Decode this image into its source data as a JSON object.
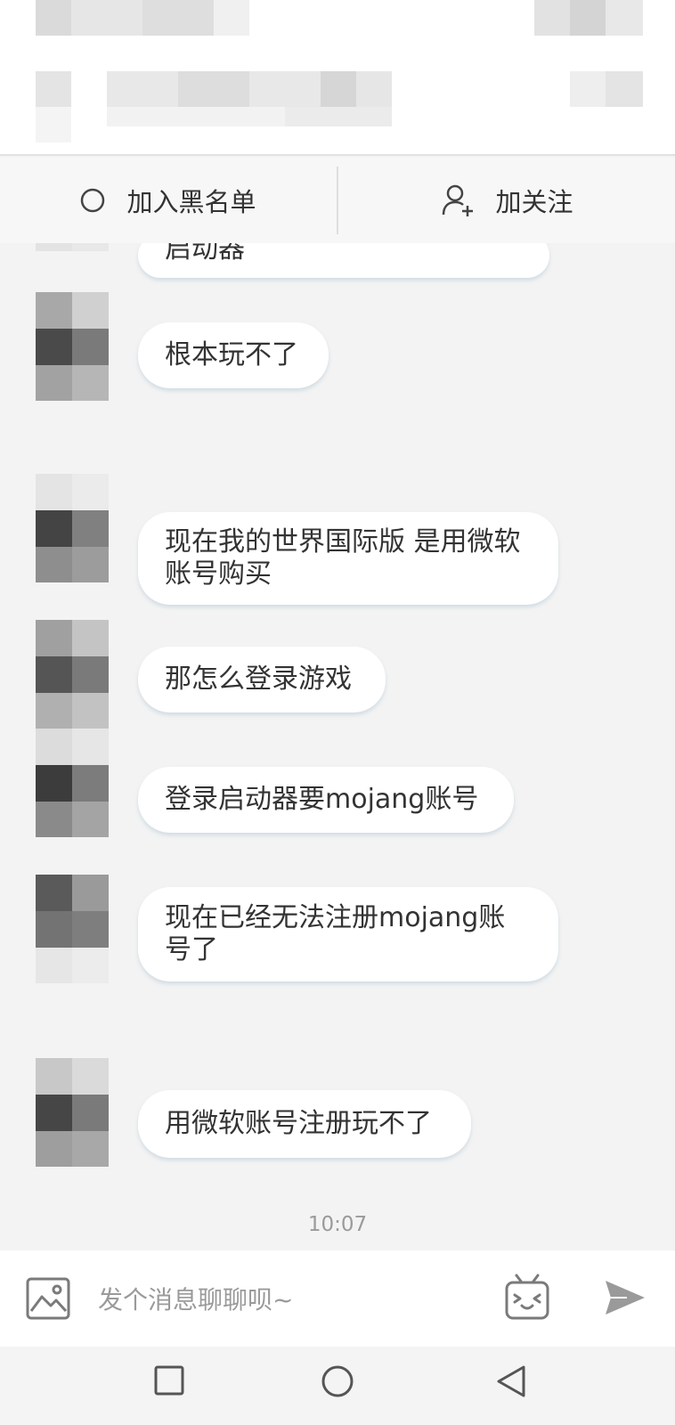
{
  "action_bar": {
    "blacklist_label": "加入黑名单",
    "follow_label": "加关注"
  },
  "messages": [
    {
      "text": "启动器"
    },
    {
      "text": "根本玩不了"
    },
    {
      "text": "现在我的世界国际版 是用微软账号购买"
    },
    {
      "text": "那怎么登录游戏"
    },
    {
      "text": "登录启动器要mojang账号"
    },
    {
      "text": "现在已经无法注册mojang账号了"
    },
    {
      "text": "用微软账号注册玩不了"
    }
  ],
  "timestamp": "10:07",
  "input": {
    "placeholder": "发个消息聊聊呗~"
  },
  "icons": {
    "image": "image-icon",
    "emoji": "tv-emoji-icon",
    "send": "send-icon",
    "add_user": "add-user-icon",
    "nav_recent": "square-icon",
    "nav_home": "circle-icon",
    "nav_back": "triangle-back-icon"
  },
  "colors": {
    "background": "#f3f3f3",
    "bubble": "#ffffff",
    "text": "#333333",
    "muted": "#9a9a9a",
    "icon": "#8a8a8a"
  }
}
